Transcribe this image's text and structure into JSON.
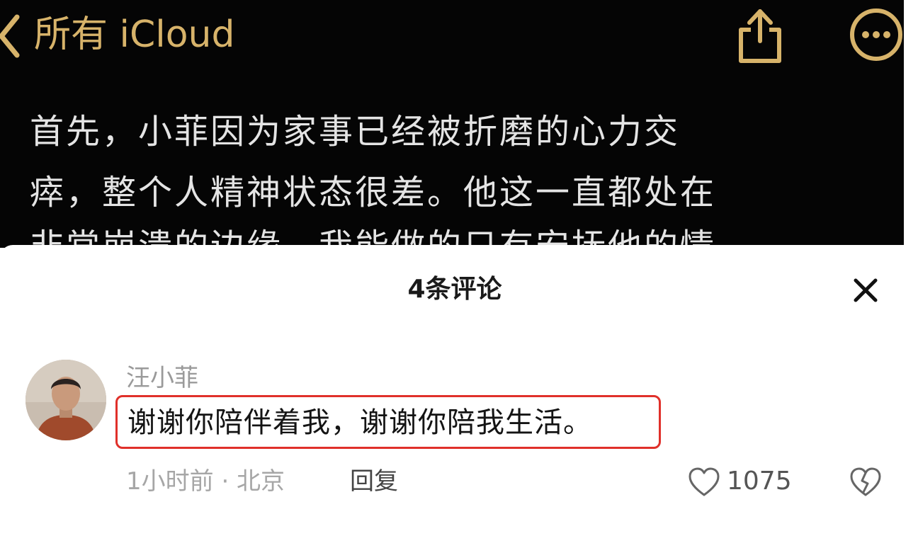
{
  "notes": {
    "back_label": "所有 iCloud",
    "lines": [
      "首先，小菲因为家事已经被折磨的心力交",
      "瘁，整个人精神状态很差。他这一直都处在",
      "非常崩溃的边缘，我能做的只有安抚他的情"
    ],
    "icons": {
      "back": "chevron-left-icon",
      "share": "share-icon",
      "more": "more-icon"
    },
    "accent_color": "#d7b36a"
  },
  "sheet": {
    "title": "4条评论",
    "close_icon": "close-icon",
    "comment": {
      "username": "汪小菲",
      "text": "谢谢你陪伴着我，谢谢你陪我生活。",
      "meta": "1小时前 · 北京",
      "reply_label": "回复",
      "like_count": "1075",
      "highlight_color": "#e0302a",
      "icons": {
        "like": "heart-icon",
        "dislike": "broken-heart-icon"
      }
    }
  }
}
